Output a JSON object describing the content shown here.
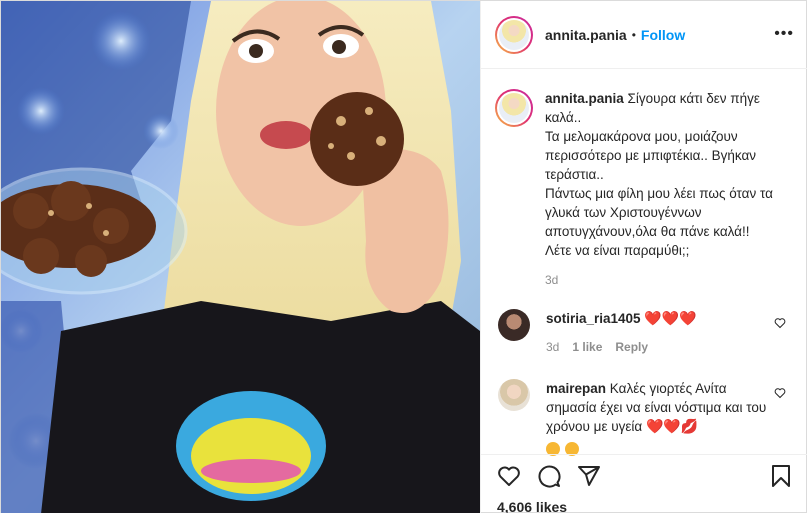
{
  "post": {
    "username": "annita.pania",
    "separator": "•",
    "follow_label": "Follow",
    "more_label": "•••",
    "caption": {
      "username": "annita.pania",
      "text": "Σίγουρα κάτι δεν πήγε καλά..\nΤα μελομακάρονα μου, μοιάζουν περισσότερο με μπιφτέκια.. Βγήκαν τεράστια..\nΠάντως μια φίλη μου λέει πως όταν τα γλυκά των Χριστουγέννων αποτυγχάνουν,όλα θα πάνε καλά!!\nΛέτε να είναι παραμύθι;;",
      "time": "3d"
    },
    "comments": [
      {
        "username": "sotiria_ria1405",
        "text": "❤️❤️❤️",
        "time": "3d",
        "likes": "1 like",
        "reply": "Reply"
      },
      {
        "username": "mairepan",
        "text": "Καλές γιορτές Ανίτα σημασία έχει να είναι νόστιμα και του χρόνου με υγεία",
        "emoji": "❤️❤️💋"
      }
    ],
    "likes": "4,606 likes"
  },
  "icons": [
    "more-options-icon",
    "heart-icon",
    "comment-icon",
    "share-icon",
    "bookmark-icon",
    "like-comment-icon"
  ],
  "colors": {
    "accent": "#0095f6",
    "text": "#262626",
    "muted": "#8e8e8e",
    "heart": "#e0245e"
  }
}
